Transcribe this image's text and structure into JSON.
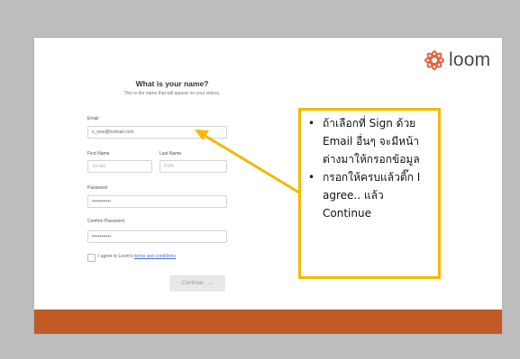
{
  "brand": {
    "name": "loom",
    "logo_icon": "loom-logo-icon",
    "accent": "#e8603c"
  },
  "form": {
    "title": "What is your name?",
    "subtitle": "This is the name that will appear on your videos.",
    "email_label": "Email",
    "email_value": "s_new@hotmail.com",
    "first_name_label": "First Name",
    "first_name_placeholder": "Jordan",
    "last_name_label": "Last Name",
    "last_name_placeholder": "Poffs",
    "password_label": "Password",
    "password_value": "••••••••••••",
    "confirm_password_label": "Confirm Password",
    "confirm_password_value": "••••••••••••",
    "agree_prefix": "I agree to Loom's ",
    "agree_link": "terms and conditions",
    "continue_label": "Continue",
    "continue_arrow": "→"
  },
  "callout": {
    "bullet": "•",
    "item1": "ถ้าเลือกที่ Sign ด้วย Email อื่นๆ จะมีหน้าต่างมาให้กรอกข้อมูล",
    "item2": "กรอกให้ครบแล้วติ๊ก I agree.. แล้ว Continue",
    "border_color": "#f5b800"
  },
  "colors": {
    "footer_bar": "#c15a25",
    "background": "#bdbdbd"
  }
}
